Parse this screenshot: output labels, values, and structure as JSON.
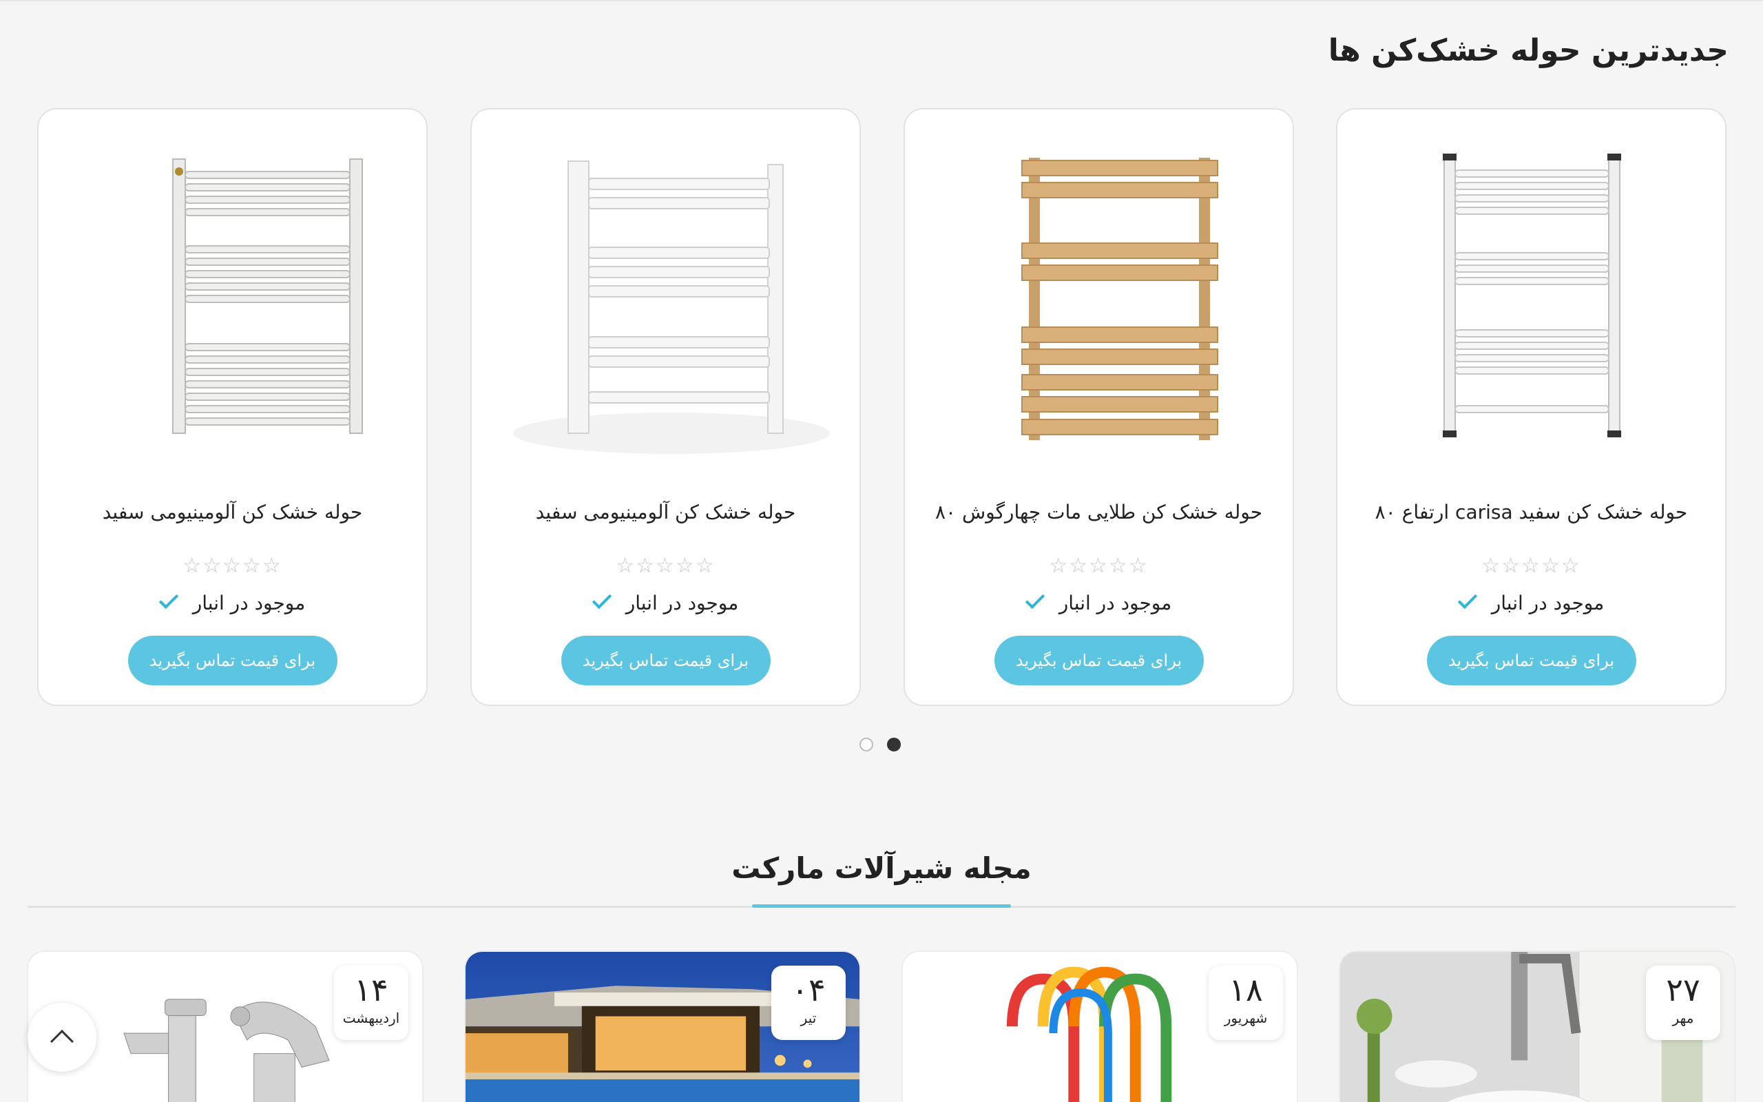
{
  "section_title": "جدیدترین حوله خشک‌کن ها",
  "products": [
    {
      "name": "حوله خشک کن سفید carisa ارتفاع ۸۰",
      "rating_stars": "☆☆☆☆☆",
      "rating": 0,
      "stock": "موجود در انبار",
      "button": "برای قیمت تماس بگیرید"
    },
    {
      "name": "حوله خشک کن طلایی مات چهارگوش ۸۰",
      "rating_stars": "☆☆☆☆☆",
      "rating": 0,
      "stock": "موجود در انبار",
      "button": "برای قیمت تماس بگیرید"
    },
    {
      "name": "حوله خشک کن آلومینیومی سفید",
      "rating_stars": "☆☆☆☆☆",
      "rating": 0,
      "stock": "موجود در انبار",
      "button": "برای قیمت تماس بگیرید"
    },
    {
      "name": "حوله خشک کن آلومینیومی سفید",
      "rating_stars": "☆☆☆☆☆",
      "rating": 0,
      "stock": "موجود در انبار",
      "button": "برای قیمت تماس بگیرید"
    }
  ],
  "slider": {
    "pages": 2,
    "active_page": 1
  },
  "magazine": {
    "title": "مجله شیرآلات مارکت",
    "posts": [
      {
        "day": "۲۷",
        "month": "مهر"
      },
      {
        "day": "۱۸",
        "month": "شهریور"
      },
      {
        "day": "۰۴",
        "month": "تیر"
      },
      {
        "day": "۱۴",
        "month": "اردیبهشت"
      }
    ]
  },
  "colors": {
    "accent": "#5cc6e2",
    "check": "#2cb7d6",
    "background": "#f5f5f5"
  },
  "icons": {
    "stock": "check-icon",
    "rating": "star-outline-icon",
    "scroll_top": "chevron-up-icon"
  }
}
